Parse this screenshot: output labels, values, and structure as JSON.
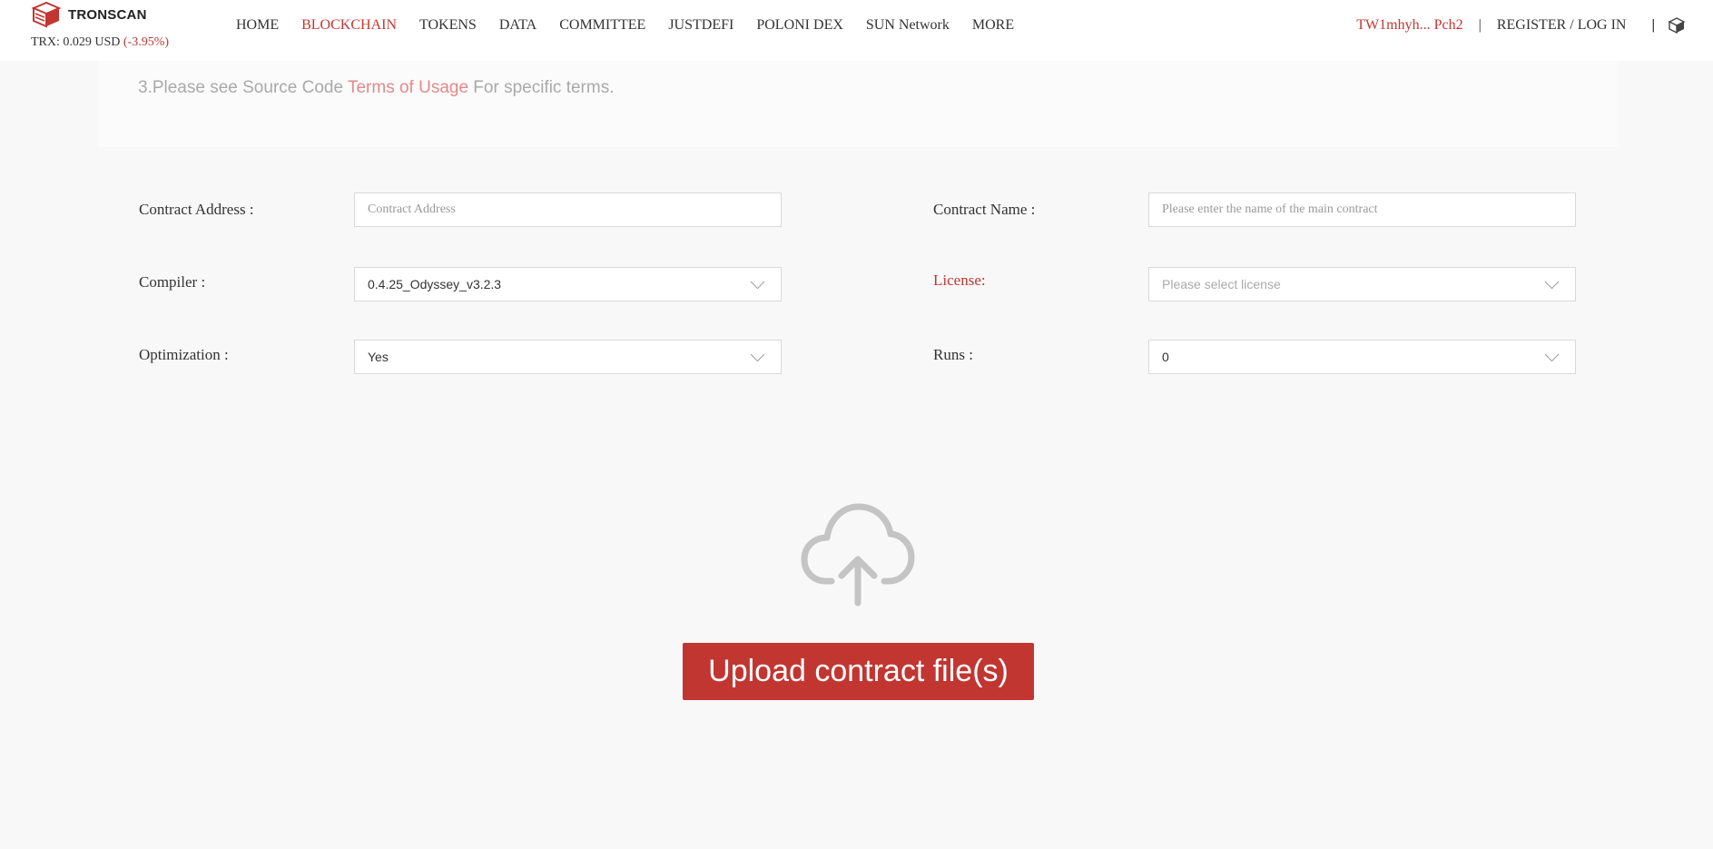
{
  "header": {
    "logo_text": "TRONSCAN",
    "price_label": "TRX: 0.029 USD",
    "price_change": "(-3.95%)",
    "nav": [
      "HOME",
      "BLOCKCHAIN",
      "TOKENS",
      "DATA",
      "COMMITTEE",
      "JUSTDEFI",
      "POLONI DEX",
      "SUN Network",
      "MORE"
    ],
    "active_nav": "BLOCKCHAIN",
    "account": "TW1mhyh... Pch2",
    "separator": "|",
    "login": "REGISTER / LOG IN",
    "separator2": "|",
    "box_icon": "box-icon"
  },
  "notice": {
    "prefix": "3.Please see Source Code ",
    "link": "Terms of Usage",
    "suffix": " For specific terms."
  },
  "form": {
    "contract_address_label": "Contract Address :",
    "contract_address_placeholder": "Contract Address",
    "contract_name_label": "Contract Name :",
    "contract_name_placeholder": "Please enter the name of the main contract",
    "compiler_label": "Compiler :",
    "compiler_value": "0.4.25_Odyssey_v3.2.3",
    "license_label": "License:",
    "license_placeholder": "Please select license",
    "optimization_label": "Optimization :",
    "optimization_value": "Yes",
    "runs_label": "Runs :",
    "runs_value": "0"
  },
  "upload": {
    "icon": "cloud-upload-icon",
    "button_label": "Upload contract file(s)"
  },
  "colors": {
    "accent": "#c23631",
    "link_light": "#e3898a",
    "background": "#f8f8f8"
  }
}
